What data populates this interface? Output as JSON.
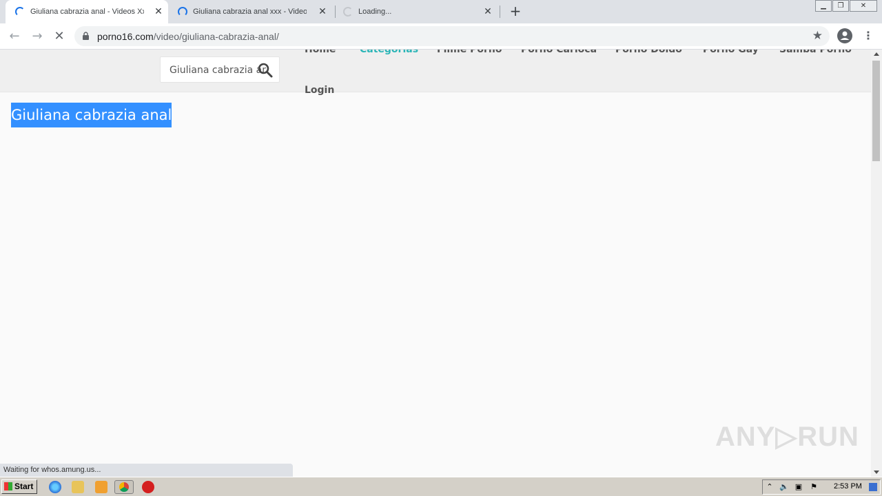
{
  "browser": {
    "tabs": [
      {
        "title": "Giuliana cabrazia anal - Videos Xxx Porno",
        "active": true
      },
      {
        "title": "Giuliana cabrazia anal xxx - Videos XXX",
        "active": false
      },
      {
        "title": "Loading...",
        "active": false
      }
    ],
    "new_tab_label": "+",
    "window_controls": {
      "minimize": "▁",
      "restore": "❐",
      "close": "✕"
    },
    "nav": {
      "back": "←",
      "forward": "→",
      "stop": "✕"
    },
    "address": {
      "domain": "porno16.com",
      "path": "/video/giuliana-cabrazia-anal/"
    },
    "bookmark_icon": "★",
    "menu_icon": "⋮"
  },
  "site": {
    "search": {
      "value": "Giuliana cabrazia anal"
    },
    "nav_links": [
      "Home",
      "Categorias",
      "Filme Porno",
      "Porno Carioca",
      "Porno Doido",
      "Porno Gay",
      "Samba Porno"
    ],
    "active_link": "Categorias",
    "login_label": "Login",
    "page_title": "Giuliana cabrazia anal"
  },
  "status_text": "Waiting for whos.amung.us...",
  "watermark": "ANY▷RUN",
  "taskbar": {
    "start_label": "Start",
    "clock": "2:53 PM"
  },
  "colors": {
    "accent_link": "#2cb5b7",
    "selection": "#3390ff"
  }
}
